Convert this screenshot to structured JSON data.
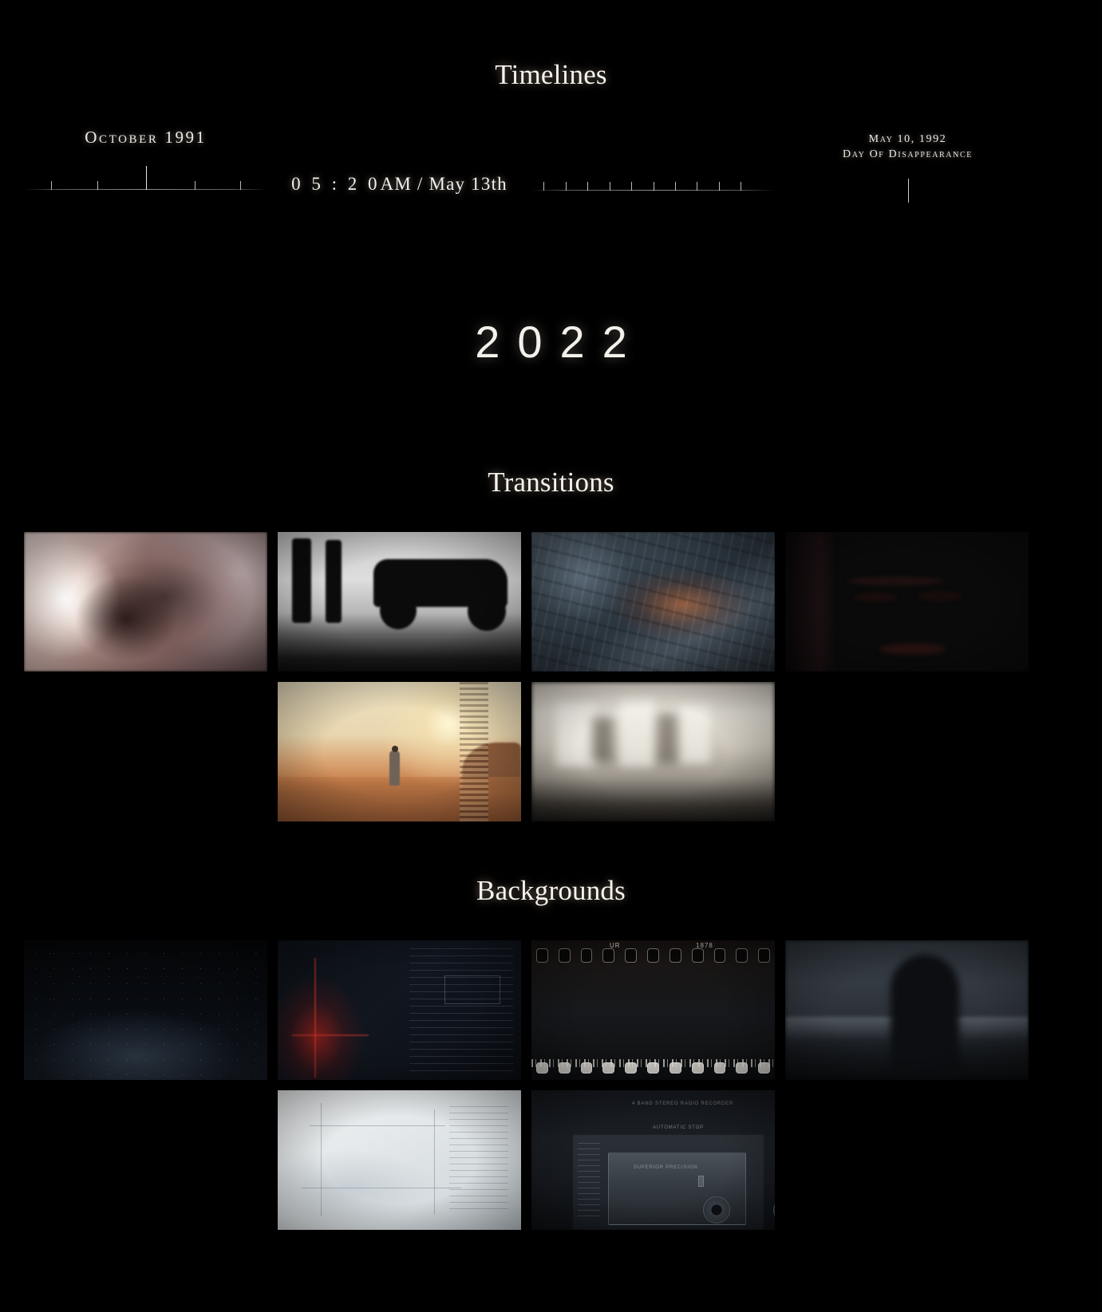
{
  "sections": {
    "timelines": {
      "heading": "Timelines"
    },
    "transitions": {
      "heading": "Transitions"
    },
    "backgrounds": {
      "heading": "Backgrounds"
    }
  },
  "timelines": {
    "items": [
      {
        "id": "october-1991",
        "label": "October 1991",
        "kind": "label-with-ruler",
        "ticks": 5,
        "playhead_index": 2
      },
      {
        "id": "clock-0520-may13",
        "digits": "0 5 : 2 0",
        "rest": "AM / May 13th",
        "kind": "clock"
      },
      {
        "id": "ruler-only",
        "kind": "ruler",
        "ticks": 10
      },
      {
        "id": "may-10-1992",
        "label_line1": "May 10, 1992",
        "label_line2": "Day Of Disappearance",
        "kind": "label-with-playhead"
      }
    ],
    "year": "2022"
  },
  "transitions": {
    "thumbnails": [
      {
        "id": "film-burn",
        "art": "art-filmburn",
        "caption": "film burn flash"
      },
      {
        "id": "car-park-blur",
        "art": "art-carpark",
        "caption": "car park silhouette"
      },
      {
        "id": "glass-smear",
        "art": "art-glassblue",
        "caption": "frosted glass smear"
      },
      {
        "id": "portrait-warm",
        "art": "art-portrait",
        "caption": "warm portrait"
      },
      {
        "id": "desert-figure",
        "art": "art-desert",
        "caption": "desert figure at dusk"
      },
      {
        "id": "motion-blur",
        "art": "art-motionblur",
        "caption": "motion blur crowd"
      }
    ]
  },
  "backgrounds": {
    "thumbnails": [
      {
        "id": "dark-field",
        "art": "art-darkfield",
        "caption": "dark field particles"
      },
      {
        "id": "red-tech-hud",
        "art": "art-redtech",
        "caption": "red tech overlay"
      },
      {
        "id": "film-strip",
        "art": "art-filmstrip",
        "caption": "film strip sprockets",
        "strip_code": "UR",
        "strip_code2": "1878"
      },
      {
        "id": "silhouette-fog",
        "art": "art-silhouette",
        "caption": "foggy silhouette"
      },
      {
        "id": "blueprint-grain",
        "art": "art-blueprint",
        "caption": "blueprint paper grain"
      },
      {
        "id": "cassette-deck",
        "art": "art-cassette",
        "caption": "cassette deck",
        "micro1": "4 BAND STEREO RADIO RECORDER",
        "micro2": "AUTOMATIC STOP",
        "micro3": "SUPERIOR PRECISION"
      }
    ]
  },
  "colors": {
    "background": "#000000",
    "text": "#f2efe9",
    "accent_warm": "#e8913e",
    "accent_red": "#c42218"
  }
}
